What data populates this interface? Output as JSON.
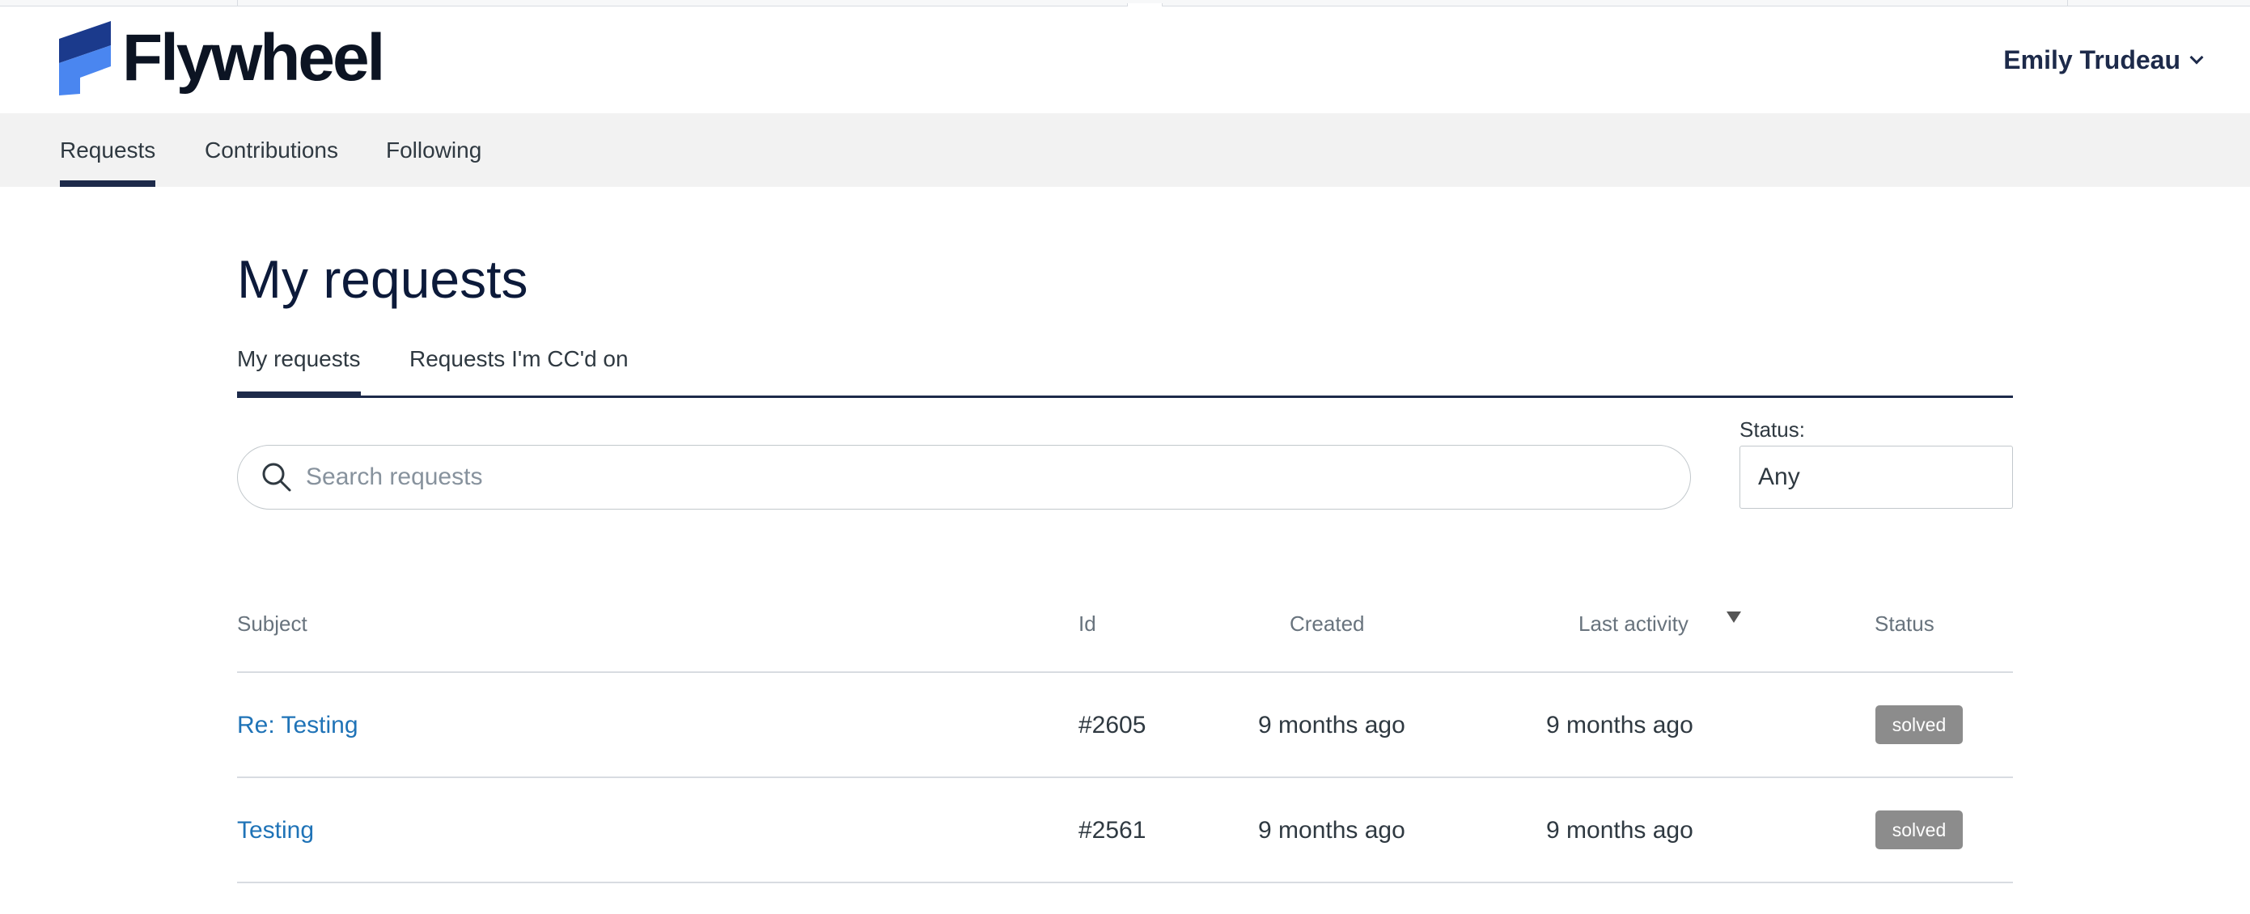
{
  "brand": {
    "name": "Flywheel"
  },
  "user": {
    "name": "Emily Trudeau"
  },
  "nav": {
    "items": [
      {
        "label": "Requests",
        "active": true
      },
      {
        "label": "Contributions",
        "active": false
      },
      {
        "label": "Following",
        "active": false
      }
    ]
  },
  "page": {
    "title": "My requests"
  },
  "subtabs": [
    {
      "label": "My requests",
      "active": true
    },
    {
      "label": "Requests I'm CC'd on",
      "active": false
    }
  ],
  "search": {
    "placeholder": "Search requests",
    "value": ""
  },
  "status_filter": {
    "label": "Status:",
    "value": "Any"
  },
  "table": {
    "headers": {
      "subject": "Subject",
      "id": "Id",
      "created": "Created",
      "last_activity": "Last activity",
      "status": "Status"
    },
    "rows": [
      {
        "subject": "Re: Testing",
        "id": "#2605",
        "created": "9 months ago",
        "last_activity": "9 months ago",
        "status": "solved"
      },
      {
        "subject": "Testing",
        "id": "#2561",
        "created": "9 months ago",
        "last_activity": "9 months ago",
        "status": "solved"
      }
    ]
  },
  "colors": {
    "brand_dark": "#1d2a4a",
    "link": "#1f73b7",
    "badge": "#8c8c8c",
    "logo_dark": "#1b3a8c",
    "logo_light": "#4a86f0"
  }
}
